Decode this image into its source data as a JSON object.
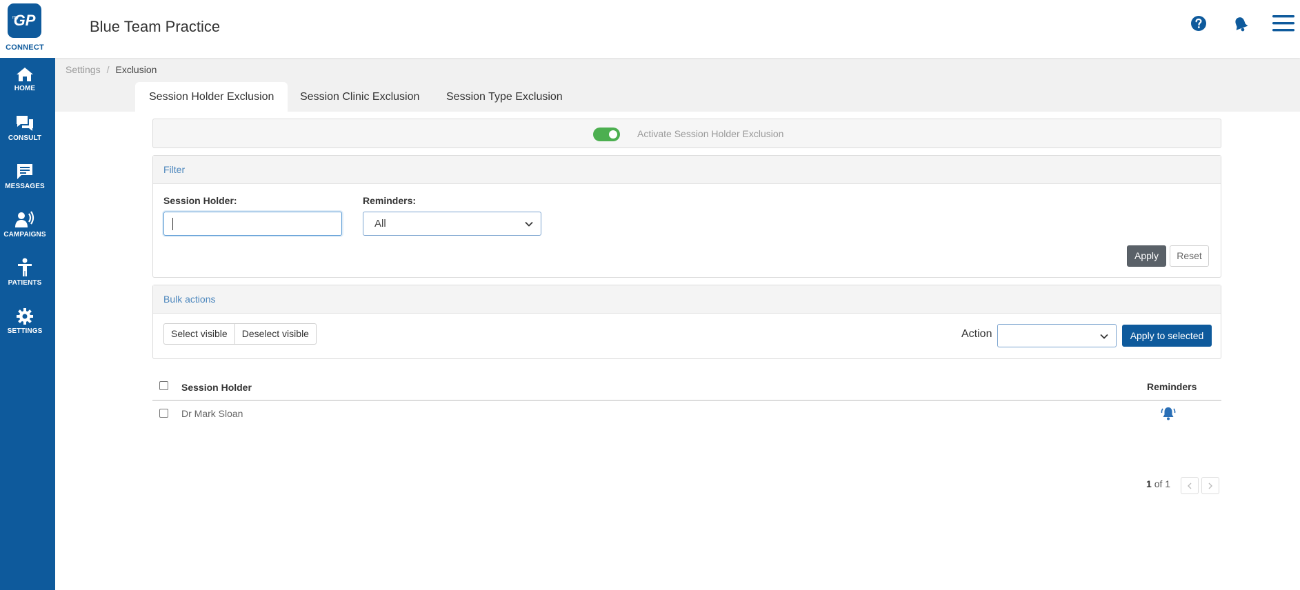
{
  "app": {
    "logo_text": "GP",
    "logo_prefix": "my",
    "logo_caption": "CONNECT",
    "title": "Blue Team Practice"
  },
  "header": {
    "icons": [
      "help-icon",
      "notification-bell-icon",
      "hamburger-menu-icon"
    ]
  },
  "sidebar": {
    "items": [
      {
        "label": "HOME",
        "icon": "home-icon"
      },
      {
        "label": "CONSULT",
        "icon": "chat-bubbles-icon"
      },
      {
        "label": "MESSAGES",
        "icon": "message-icon"
      },
      {
        "label": "CAMPAIGNS",
        "icon": "megaphone-person-icon"
      },
      {
        "label": "PATIENTS",
        "icon": "person-icon"
      },
      {
        "label": "SETTINGS",
        "icon": "gear-icon"
      }
    ]
  },
  "breadcrumb": {
    "parent": "Settings",
    "separator": "/",
    "current": "Exclusion"
  },
  "tabs": [
    {
      "label": "Session Holder Exclusion",
      "active": true
    },
    {
      "label": "Session Clinic Exclusion",
      "active": false
    },
    {
      "label": "Session Type Exclusion",
      "active": false
    }
  ],
  "activation": {
    "label": "Activate Session Holder Exclusion",
    "enabled": true
  },
  "filter": {
    "title": "Filter",
    "session_holder_label": "Session Holder:",
    "session_holder_value": "",
    "reminders_label": "Reminders:",
    "reminders_value": "All",
    "apply_label": "Apply",
    "reset_label": "Reset"
  },
  "bulk": {
    "title": "Bulk actions",
    "select_visible": "Select visible",
    "deselect_visible": "Deselect visible",
    "action_label": "Action",
    "action_value": "",
    "apply_selected": "Apply to selected"
  },
  "table": {
    "columns": [
      "Session Holder",
      "Reminders"
    ],
    "rows": [
      {
        "session_holder": "Dr Mark Sloan",
        "reminders_icon": "notification-bell-icon"
      }
    ]
  },
  "pagination": {
    "current": "1",
    "of_text": "of 1"
  },
  "colors": {
    "brand": "#0e5a9c",
    "toggle_on": "#4caf50",
    "link": "#4d87bd"
  }
}
